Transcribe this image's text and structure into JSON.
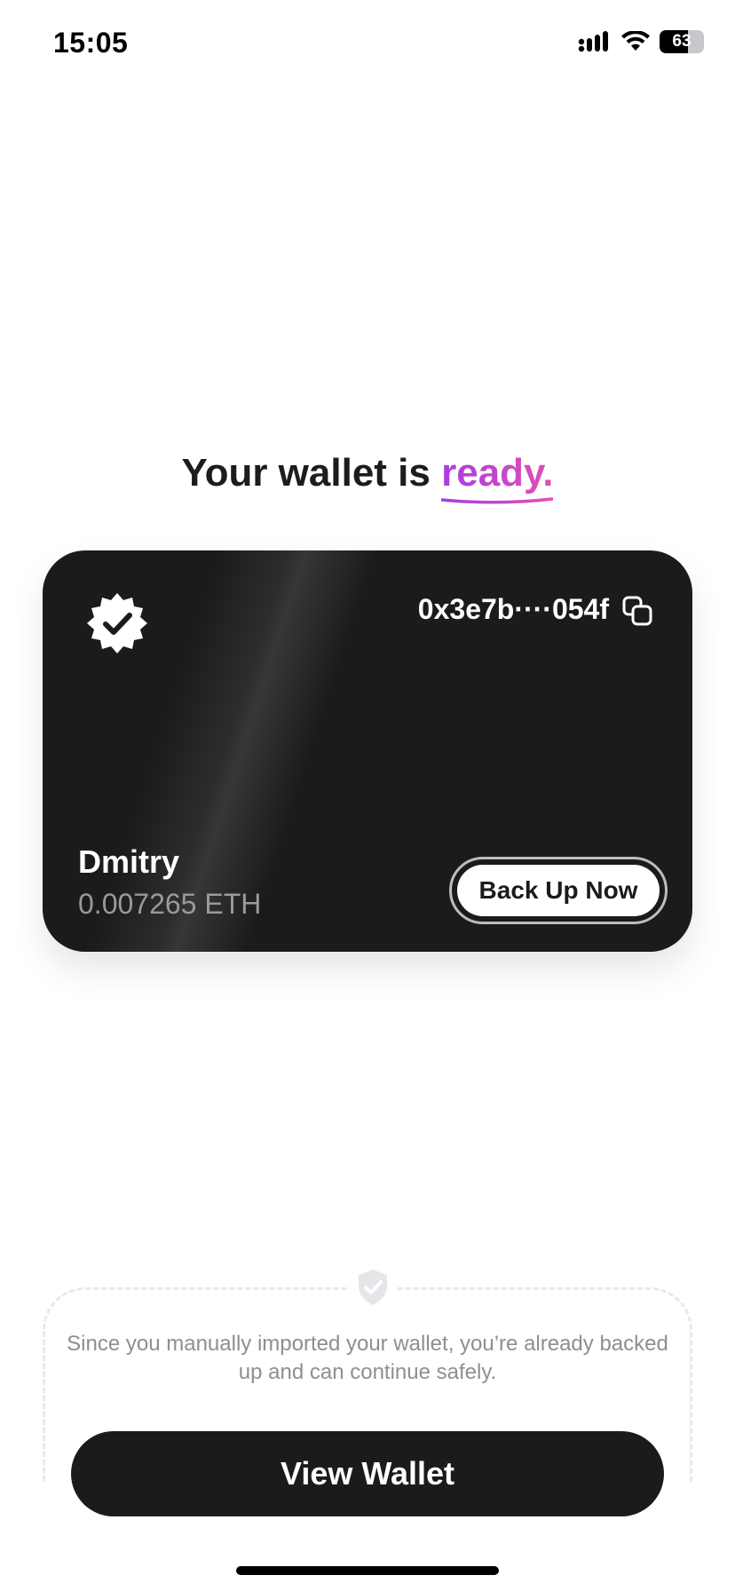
{
  "status_bar": {
    "time": "15:05",
    "battery_level": "63",
    "battery_fraction": 0.63
  },
  "headline": {
    "prefix": "Your wallet is ",
    "accent": "ready."
  },
  "card": {
    "address": "0x3e7b····054f",
    "name": "Dmitry",
    "balance": "0.007265 ETH",
    "backup_label": "Back Up Now"
  },
  "info": {
    "message": "Since you manually imported your wallet, you’re already backed up and can continue safely."
  },
  "primary_button": {
    "label": "View Wallet"
  },
  "colors": {
    "card_background": "#1b1b1b",
    "accent_start": "#a73ee0",
    "accent_end": "#e04fb6",
    "muted_text": "#8e8e93"
  }
}
